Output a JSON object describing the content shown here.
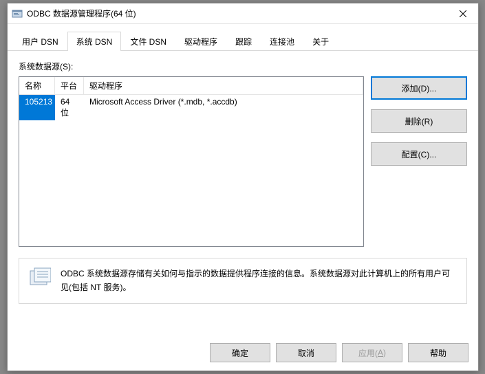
{
  "window": {
    "title": "ODBC 数据源管理程序(64 位)"
  },
  "tabs": [
    {
      "label": "用户 DSN"
    },
    {
      "label": "系统 DSN"
    },
    {
      "label": "文件 DSN"
    },
    {
      "label": "驱动程序"
    },
    {
      "label": "跟踪"
    },
    {
      "label": "连接池"
    },
    {
      "label": "关于"
    }
  ],
  "section_label": "系统数据源(S):",
  "columns": {
    "name": "名称",
    "platform": "平台",
    "driver": "驱动程序"
  },
  "rows": [
    {
      "name": "105213",
      "platform": "64 位",
      "driver": "Microsoft Access Driver (*.mdb, *.accdb)"
    }
  ],
  "side_buttons": {
    "add": "添加(D)...",
    "remove": "删除(R)",
    "config": "配置(C)..."
  },
  "info_text": "ODBC 系统数据源存储有关如何与指示的数据提供程序连接的信息。系统数据源对此计算机上的所有用户可见(包括 NT 服务)。",
  "footer": {
    "ok": "确定",
    "cancel": "取消",
    "apply_pre": "应用(",
    "apply_u": "A",
    "apply_post": ")",
    "help": "帮助"
  }
}
